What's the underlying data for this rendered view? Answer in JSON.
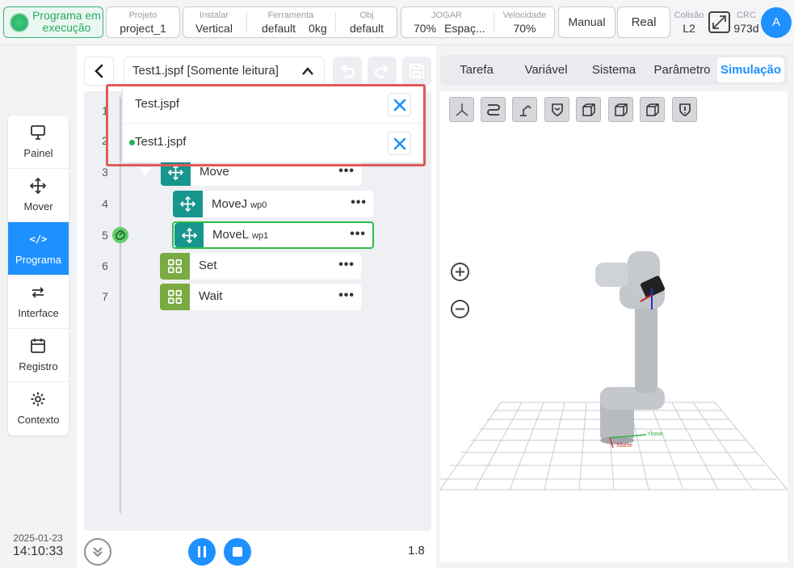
{
  "topbar": {
    "status": "Programa em execução",
    "projeto": {
      "label": "Projeto",
      "value": "project_1"
    },
    "instalar": {
      "label": "Instalar",
      "value": "Vertical"
    },
    "ferramenta": {
      "label": "Ferramenta",
      "value": "default",
      "weight": "0kg"
    },
    "obj": {
      "label": "Obj",
      "value": "default"
    },
    "jogar": {
      "label": "JOGAR",
      "value": "70%",
      "mode": "Espaç..."
    },
    "velocidade": {
      "label": "Velocidade",
      "value": "70%"
    },
    "manual_label": "Manual",
    "real_label": "Real",
    "colisao": {
      "label": "Colisão",
      "value": "L2"
    },
    "crc": {
      "label": "CRC",
      "value": "973d"
    },
    "avatar": "A"
  },
  "nav": {
    "items": [
      {
        "label": "Painel",
        "icon": "monitor-icon"
      },
      {
        "label": "Mover",
        "icon": "move-icon"
      },
      {
        "label": "Programa",
        "icon": "code-icon",
        "active": true
      },
      {
        "label": "Interface",
        "icon": "swap-icon"
      },
      {
        "label": "Registro",
        "icon": "calendar-icon"
      },
      {
        "label": "Contexto",
        "icon": "gear-icon"
      }
    ],
    "code_glyph": "</>"
  },
  "datetime": {
    "date": "2025-01-23",
    "time": "14:10:33"
  },
  "program": {
    "current_file": "Test1.jspf [Somente leitura]",
    "files": [
      {
        "name": "Test.jspf",
        "active": false
      },
      {
        "name": "Test1.jspf",
        "active": true
      }
    ],
    "lines": [
      "1",
      "2",
      "3",
      "4",
      "5",
      "6",
      "7"
    ],
    "blocks": [
      {
        "name": "Move",
        "sub": "",
        "icon": "move-icon",
        "color": "#16968d"
      },
      {
        "name": "MoveJ",
        "sub": "wp0",
        "icon": "move-icon",
        "color": "#16968d"
      },
      {
        "name": "MoveL",
        "sub": "wp1",
        "icon": "move-icon",
        "color": "#16968d",
        "selected": true
      },
      {
        "name": "Set",
        "sub": "",
        "icon": "grid-icon",
        "color": "#7aab43"
      },
      {
        "name": "Wait",
        "sub": "",
        "icon": "grid-icon",
        "color": "#7aab43"
      }
    ],
    "more": "•••",
    "speed": "1.8"
  },
  "tabs": [
    "Tarefa",
    "Variável",
    "Sistema",
    "Parâmetro",
    "Simulação"
  ],
  "active_tab": "Simulação",
  "axes": {
    "x": "Xbase",
    "y": "Ybase"
  },
  "colors": {
    "accent": "#1e90ff",
    "teal": "#16968d",
    "green": "#7aab43",
    "highlight": "#e05a5a"
  }
}
